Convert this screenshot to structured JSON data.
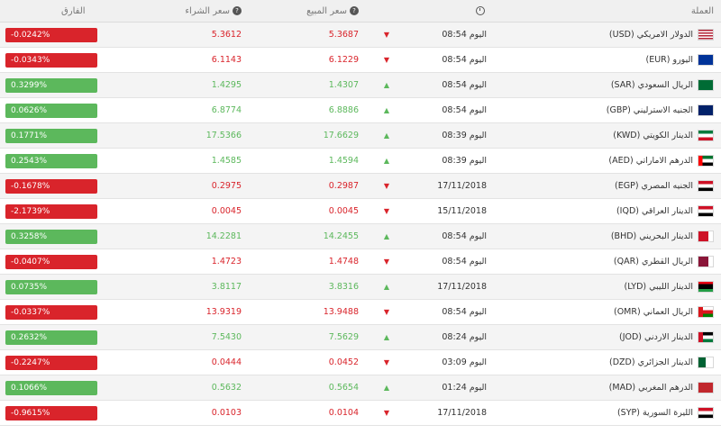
{
  "header": {
    "currency": "العملة",
    "sell": "سعر المبيع",
    "buy": "سعر الشراء",
    "change": "الفارق",
    "help_icon": "?",
    "time_icon": "clock-icon"
  },
  "colors": {
    "up": "#5cb85c",
    "down": "#d9242b"
  },
  "rows": [
    {
      "name": "الدولار الامريكي (USD)",
      "flag": "us",
      "time": "اليوم 08:54",
      "dir": "down",
      "sell": "5.3687",
      "buy": "5.3612",
      "change": "-0.0242%"
    },
    {
      "name": "اليورو (EUR)",
      "flag": "eu",
      "time": "اليوم 08:54",
      "dir": "down",
      "sell": "6.1229",
      "buy": "6.1143",
      "change": "-0.0343%"
    },
    {
      "name": "الريال السعودي (SAR)",
      "flag": "sa",
      "time": "اليوم 08:54",
      "dir": "up",
      "sell": "1.4307",
      "buy": "1.4295",
      "change": "0.3299%"
    },
    {
      "name": "الجنيه الاسترليني (GBP)",
      "flag": "gb",
      "time": "اليوم 08:54",
      "dir": "up",
      "sell": "6.8886",
      "buy": "6.8774",
      "change": "0.0626%"
    },
    {
      "name": "الدينار الكويتي (KWD)",
      "flag": "kw",
      "time": "اليوم 08:39",
      "dir": "up",
      "sell": "17.6629",
      "buy": "17.5366",
      "change": "0.1771%"
    },
    {
      "name": "الدرهم الاماراتي (AED)",
      "flag": "ae",
      "time": "اليوم 08:39",
      "dir": "up",
      "sell": "1.4594",
      "buy": "1.4585",
      "change": "0.2543%"
    },
    {
      "name": "الجنيه المصري (EGP)",
      "flag": "eg",
      "time": "17/11/2018",
      "dir": "down",
      "sell": "0.2987",
      "buy": "0.2975",
      "change": "-0.1678%"
    },
    {
      "name": "الدينار العراقي (IQD)",
      "flag": "iq",
      "time": "15/11/2018",
      "dir": "down",
      "sell": "0.0045",
      "buy": "0.0045",
      "change": "-2.1739%"
    },
    {
      "name": "الدينار البحريني (BHD)",
      "flag": "bh",
      "time": "اليوم 08:54",
      "dir": "up",
      "sell": "14.2455",
      "buy": "14.2281",
      "change": "0.3258%"
    },
    {
      "name": "الريال القطري (QAR)",
      "flag": "qa",
      "time": "اليوم 08:54",
      "dir": "down",
      "sell": "1.4748",
      "buy": "1.4723",
      "change": "-0.0407%"
    },
    {
      "name": "الدينار الليبي (LYD)",
      "flag": "ly",
      "time": "17/11/2018",
      "dir": "up",
      "sell": "3.8316",
      "buy": "3.8117",
      "change": "0.0735%"
    },
    {
      "name": "الريال العماني (OMR)",
      "flag": "om",
      "time": "اليوم 08:54",
      "dir": "down",
      "sell": "13.9488",
      "buy": "13.9319",
      "change": "-0.0337%"
    },
    {
      "name": "الدينار الاردني (JOD)",
      "flag": "jo",
      "time": "اليوم 08:24",
      "dir": "up",
      "sell": "7.5629",
      "buy": "7.5430",
      "change": "0.2632%"
    },
    {
      "name": "الدينار الجزائري (DZD)",
      "flag": "dz",
      "time": "اليوم 03:09",
      "dir": "down",
      "sell": "0.0452",
      "buy": "0.0444",
      "change": "-0.2247%"
    },
    {
      "name": "الدرهم المغربي (MAD)",
      "flag": "ma",
      "time": "اليوم 01:24",
      "dir": "up",
      "sell": "0.5654",
      "buy": "0.5632",
      "change": "0.1066%"
    },
    {
      "name": "الليرة السورية (SYP)",
      "flag": "sy",
      "time": "17/11/2018",
      "dir": "down",
      "sell": "0.0104",
      "buy": "0.0103",
      "change": "-0.9615%"
    }
  ]
}
